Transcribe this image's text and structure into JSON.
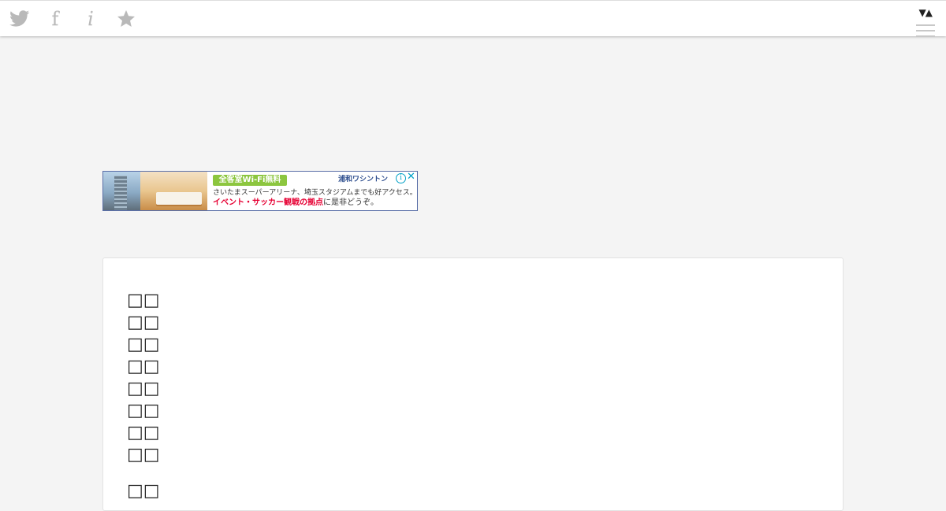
{
  "toolbar": {
    "icons": [
      {
        "name": "twitter-icon"
      },
      {
        "name": "facebook-icon",
        "glyph": "f"
      },
      {
        "name": "info-icon",
        "glyph": "i"
      },
      {
        "name": "star-icon"
      }
    ],
    "sort_glyph": "▼▲"
  },
  "ad": {
    "badge": "全客室Wi-Fi無料",
    "brand": "浦和ワシントン",
    "info_glyph": "i",
    "close_glyph": "✕",
    "line1": "さいたまスーパーアリーナ、埼玉スタジアムまでも好アクセス。",
    "line2_highlight": "イベント・サッカー観戦の拠点",
    "line2_rest": "に是非どうぞ。"
  },
  "content": {
    "lines": [
      "□□",
      "□□",
      "□□",
      "□□",
      "□□",
      "□□",
      "□□",
      "□□"
    ],
    "after_gap_line": "□□"
  },
  "colors": {
    "icon_gray": "#b9b9b9",
    "background": "#f4f4f4",
    "ad_green": "#8cc63f",
    "ad_red": "#e60033"
  }
}
